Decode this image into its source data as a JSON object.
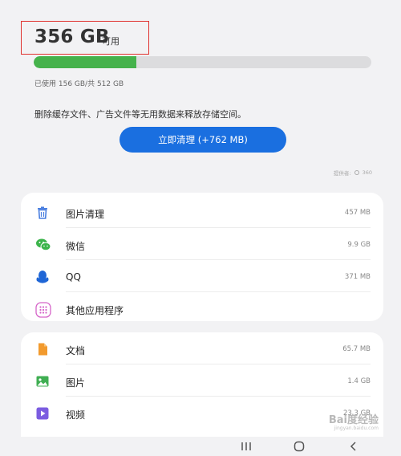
{
  "storage": {
    "available_value": "356 GB",
    "available_label": "可用",
    "used_fraction": 0.3047,
    "used_text": "已使用 156 GB/共 512 GB"
  },
  "description": "删除缓存文件、广告文件等无用数据来释放存储空间。",
  "clean_button_label": "立即清理 (+762 MB)",
  "provider": {
    "label": "提供者:",
    "name": "360"
  },
  "apps": [
    {
      "label": "图片清理",
      "size": "457 MB",
      "icon": "trash-icon"
    },
    {
      "label": "微信",
      "size": "9.9 GB",
      "icon": "wechat-icon"
    },
    {
      "label": "QQ",
      "size": "371 MB",
      "icon": "qq-penguin-icon"
    },
    {
      "label": "其他应用程序",
      "size": "",
      "icon": "apps-grid-icon"
    }
  ],
  "files": [
    {
      "label": "文档",
      "size": "65.7 MB",
      "icon": "document-icon"
    },
    {
      "label": "图片",
      "size": "1.4 GB",
      "icon": "image-icon"
    },
    {
      "label": "视频",
      "size": "23.3 GB",
      "icon": "video-icon"
    }
  ],
  "watermark": {
    "text": "Bai度经验",
    "sub": "jingyan.baidu.com"
  },
  "colors": {
    "accent": "#1a6fe0",
    "usage_bar": "#45b24b",
    "highlight_box": "#e0322f"
  }
}
